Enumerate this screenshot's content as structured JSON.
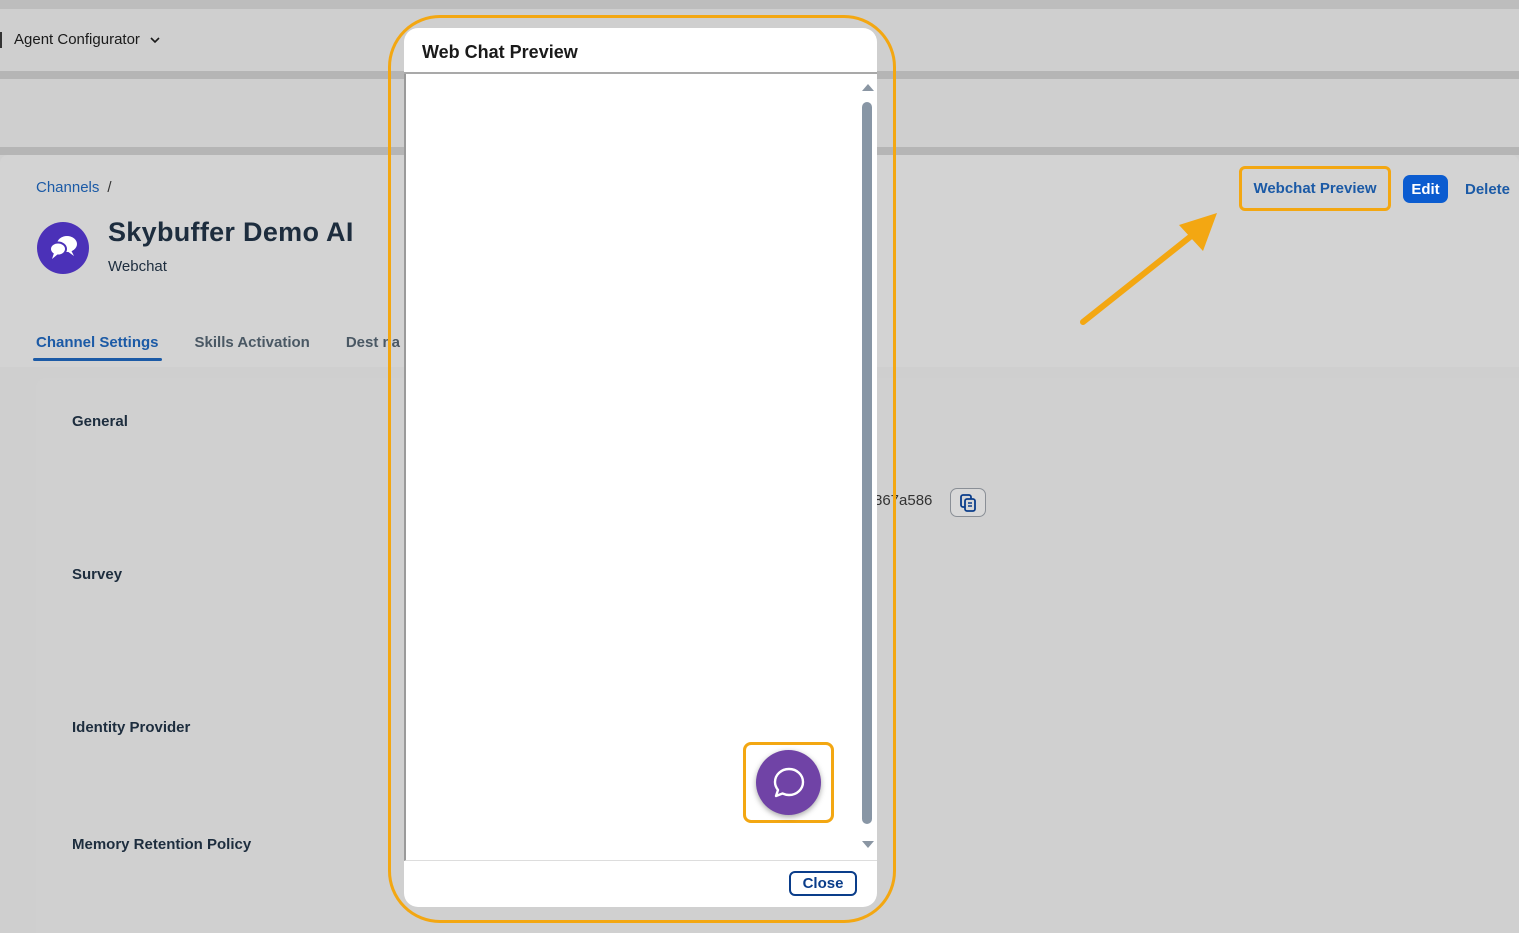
{
  "shell": {
    "app_title": "Agent Configurator"
  },
  "breadcrumb": {
    "link": "Channels",
    "separator": "/"
  },
  "object": {
    "title": "Skybuffer Demo AI",
    "subtitle": "Webchat"
  },
  "actions": {
    "preview": "Webchat Preview",
    "edit": "Edit",
    "delete": "Delete"
  },
  "tabs": [
    {
      "label": "Channel Settings",
      "active": true
    },
    {
      "label": "Skills Activation",
      "active": false
    },
    {
      "label": "Dest na",
      "active": false
    }
  ],
  "sections": [
    "General",
    "Survey",
    "Identity Provider",
    "Memory Retention Policy"
  ],
  "general": {
    "id_fragment": ")867a586"
  },
  "dialog": {
    "title": "Web Chat Preview",
    "close": "Close"
  },
  "colors": {
    "accent": "#0b5cd0",
    "highlight": "#f3a712",
    "avatar": "#4b31b8",
    "launcher": "#7043a6"
  }
}
